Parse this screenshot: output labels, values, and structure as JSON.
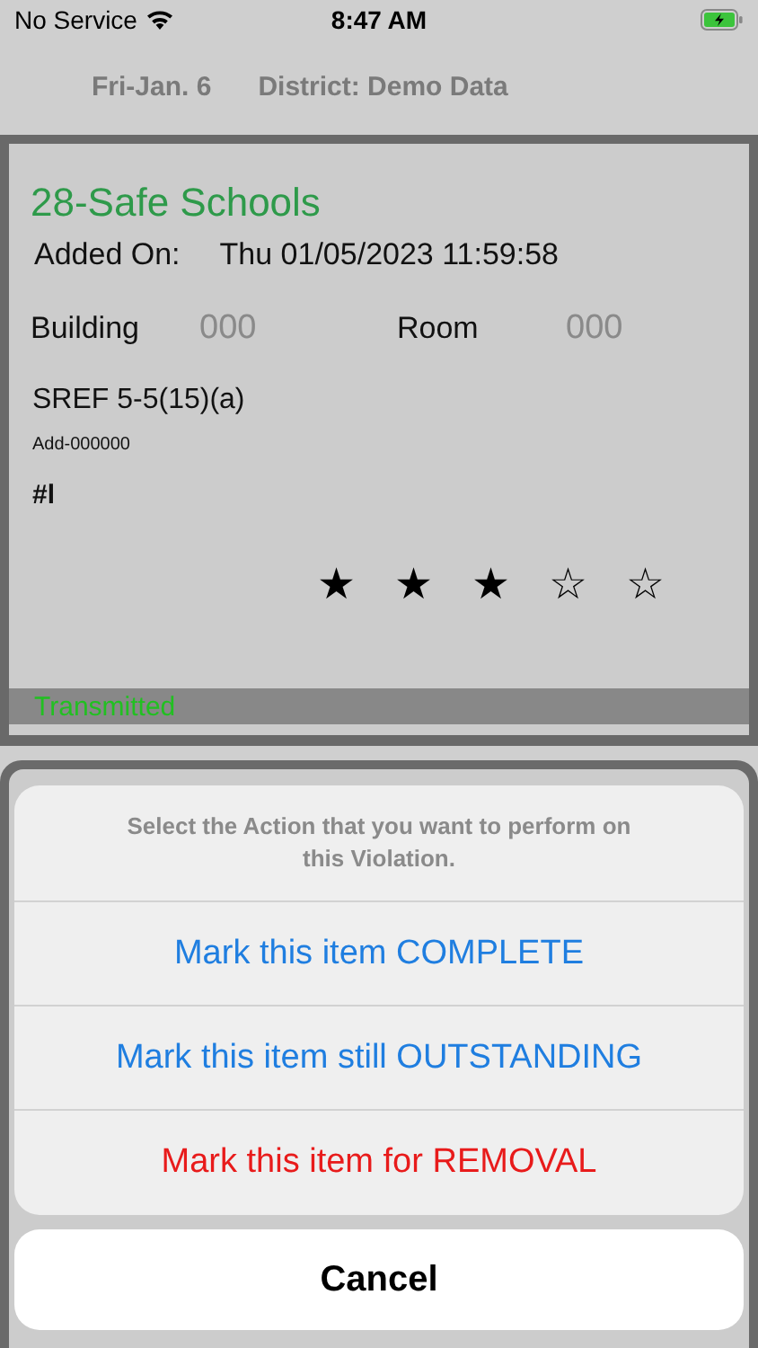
{
  "status_bar": {
    "carrier": "No Service",
    "time": "8:47 AM",
    "battery_charging": true
  },
  "header": {
    "date": "Fri-Jan. 6",
    "district": "District: Demo Data"
  },
  "card": {
    "title": "28-Safe Schools",
    "added_label": "Added On:",
    "added_value": "Thu 01/05/2023 11:59:58",
    "building_label": "Building",
    "building_value": "000",
    "room_label": "Room",
    "room_value": "000",
    "code": "SREF 5-5(15)(a)",
    "add_id": "Add-000000",
    "note": "#l",
    "stars": 3,
    "status": "Transmitted"
  },
  "action_sheet": {
    "message": "Select the Action that you want to perform on this Violation.",
    "actions": [
      {
        "label": "Mark this item COMPLETE",
        "kind": "default"
      },
      {
        "label": "Mark this item still OUTSTANDING",
        "kind": "default"
      },
      {
        "label": "Mark this item for REMOVAL",
        "kind": "destructive"
      }
    ],
    "cancel": "Cancel"
  }
}
